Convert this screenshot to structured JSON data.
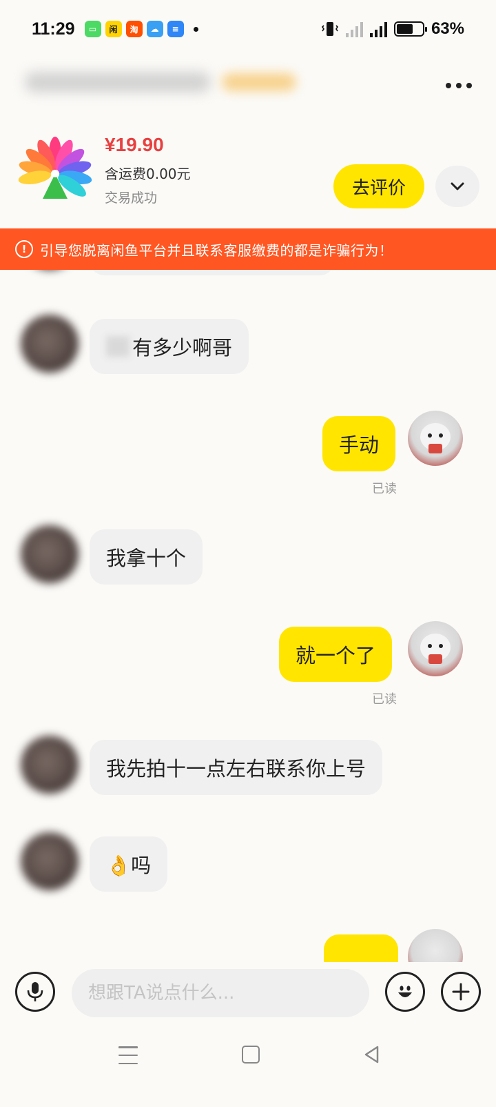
{
  "status_bar": {
    "time": "11:29",
    "battery_percent": "63%",
    "battery_level": 0.63,
    "apps": [
      {
        "name": "messages-app",
        "color": "#4cd964",
        "glyph": "▭"
      },
      {
        "name": "xianyu-app",
        "color": "#ffd400",
        "glyph": "闲"
      },
      {
        "name": "taobao-app",
        "color": "#ff4f00",
        "glyph": "淘"
      },
      {
        "name": "weather-app",
        "color": "#3aa0f3",
        "glyph": "☁"
      },
      {
        "name": "wallet-app",
        "color": "#2f86f6",
        "glyph": "≡"
      }
    ],
    "network": "5G"
  },
  "product": {
    "price": "¥19.90",
    "shipping": "含运费0.00元",
    "status": "交易成功",
    "review_label": "去评价"
  },
  "warning": {
    "icon": "exclamation-icon",
    "text": "引导您脱离闲鱼平台并且联系客服缴费的都是诈骗行为！"
  },
  "messages": [
    {
      "from": "other",
      "text": "有多少啊哥",
      "blur_prefix": true
    },
    {
      "from": "self",
      "text": "手动",
      "status": "已读"
    },
    {
      "from": "other",
      "text": "我拿十个"
    },
    {
      "from": "self",
      "text": "就一个了",
      "status": "已读"
    },
    {
      "from": "other",
      "text": "我先拍十一点左右联系你上号"
    },
    {
      "from": "other",
      "text": "👌吗"
    }
  ],
  "input": {
    "placeholder": "想跟TA说点什么..."
  },
  "colors": {
    "accent": "#ffe500",
    "price": "#e74040",
    "warning_bg": "#ff5622"
  }
}
